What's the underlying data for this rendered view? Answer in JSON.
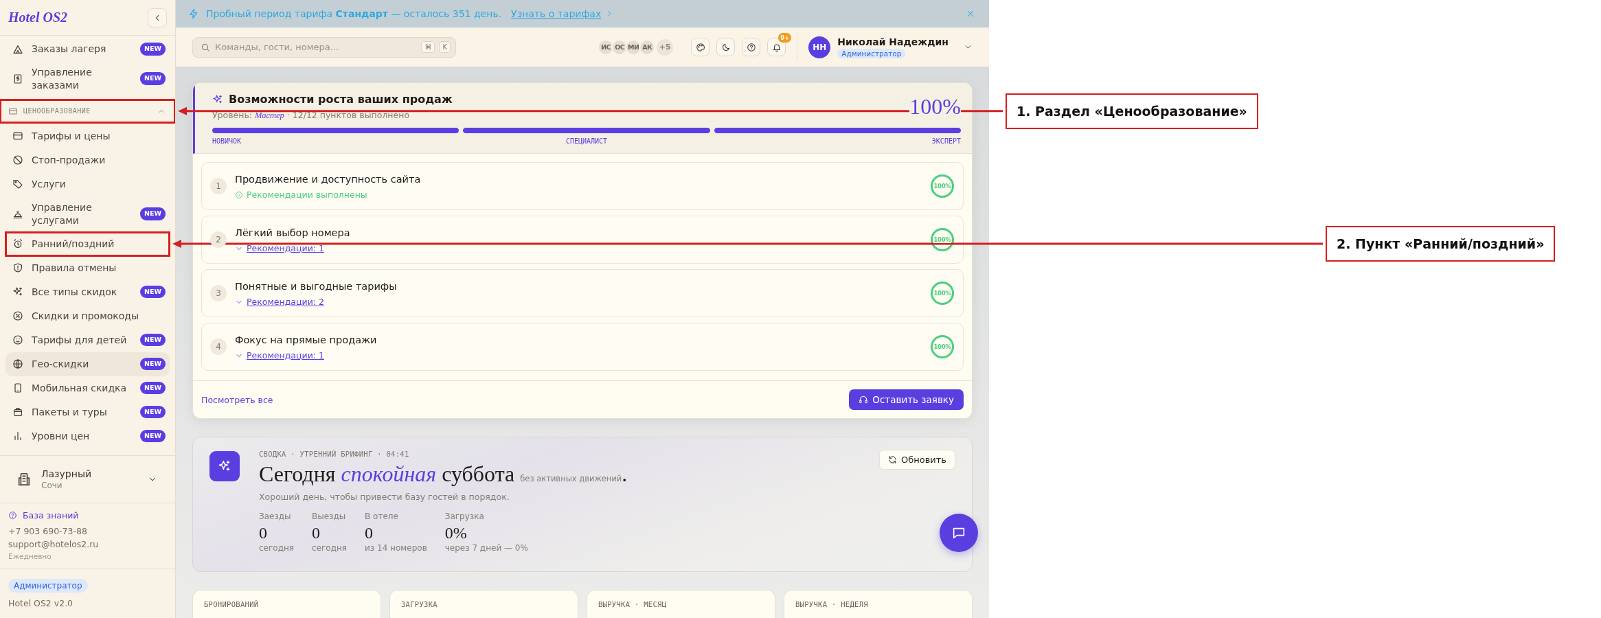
{
  "sidebar": {
    "logo": "Hotel OS2",
    "nav": [
      {
        "kind": "item",
        "label": "Заказы лагеря",
        "badge": "NEW",
        "selected": false,
        "highlighted": false
      },
      {
        "kind": "item",
        "label": "Управление заказами",
        "badge": "NEW",
        "selected": false,
        "highlighted": false
      },
      {
        "kind": "section",
        "label": "ЦЕНООБРАЗОВАНИЕ",
        "expanded": true,
        "highlighted": true
      },
      {
        "kind": "item",
        "label": "Тарифы и цены",
        "selected": false,
        "highlighted": false
      },
      {
        "kind": "item",
        "label": "Стоп-продажи",
        "selected": false,
        "highlighted": false
      },
      {
        "kind": "item",
        "label": "Услуги",
        "selected": false,
        "highlighted": false
      },
      {
        "kind": "item",
        "label": "Управление услугами",
        "badge": "NEW",
        "selected": false,
        "highlighted": false
      },
      {
        "kind": "item",
        "label": "Ранний/поздний",
        "selected": false,
        "highlighted": true
      },
      {
        "kind": "item",
        "label": "Правила отмены",
        "selected": false,
        "highlighted": false
      },
      {
        "kind": "item",
        "label": "Все типы скидок",
        "badge": "NEW",
        "selected": false,
        "highlighted": false
      },
      {
        "kind": "item",
        "label": "Скидки и промокоды",
        "selected": false,
        "highlighted": false
      },
      {
        "kind": "item",
        "label": "Тарифы для детей",
        "badge": "NEW",
        "selected": false,
        "highlighted": false
      },
      {
        "kind": "item",
        "label": "Гео-скидки",
        "badge": "NEW",
        "selected": true,
        "highlighted": false
      },
      {
        "kind": "item",
        "label": "Мобильная скидка",
        "badge": "NEW",
        "selected": false,
        "highlighted": false
      },
      {
        "kind": "item",
        "label": "Пакеты и туры",
        "badge": "NEW",
        "selected": false,
        "highlighted": false
      },
      {
        "kind": "item",
        "label": "Уровни цен",
        "badge": "NEW",
        "selected": false,
        "highlighted": false
      }
    ],
    "property": {
      "name": "Лазурный",
      "city": "Сочи"
    },
    "help": {
      "link": "База знаний",
      "phone": "+7 903 690-73-88",
      "email": "support@hotelos2.ru",
      "hours": "Ежедневно"
    },
    "footer": {
      "role": "Администратор",
      "version": "Hotel OS2 v2.0"
    }
  },
  "banner": {
    "text": "Пробный период тарифа **Стандарт** — осталось 351 день.",
    "link": "Узнать о тарифах"
  },
  "topbar": {
    "search": {
      "placeholder": "Команды, гости, номера...",
      "keys": [
        "⌘",
        "K"
      ]
    },
    "avatars": [
      "ИС",
      "ОС",
      "МИ",
      "АК"
    ],
    "more": "+5",
    "notifications": "9+",
    "user": {
      "initials": "НН",
      "name": "Николай Надеждин",
      "role": "Администратор"
    }
  },
  "growth": {
    "title": "Возможности роста ваших продаж",
    "level_line": "Уровень: *Мастер* · 12/12 пунктов выполнено",
    "percent": "100%",
    "stages": [
      {
        "label": "НОВИЧОК",
        "level": 1
      },
      {
        "label": "СПЕЦИАЛИСТ",
        "level": 1
      },
      {
        "label": "ЭКСПЕРТ",
        "level": 1
      }
    ],
    "tasks": [
      {
        "number": "1",
        "title": "Продвижение и доступность сайта",
        "kind": "done",
        "status": "Рекомендации выполнены",
        "percent": "100%",
        "level": 1
      },
      {
        "number": "2",
        "title": "Лёгкий выбор номера",
        "kind": "recs",
        "status": "Рекомендации: 1",
        "percent": "100%",
        "level": 1
      },
      {
        "number": "3",
        "title": "Понятные и выгодные тарифы",
        "kind": "recs",
        "status": "Рекомендации: 2",
        "percent": "100%",
        "level": 1
      },
      {
        "number": "4",
        "title": "Фокус на прямые продажи",
        "kind": "recs",
        "status": "Рекомендации: 1",
        "percent": "100%",
        "level": 1
      }
    ],
    "view_all": "Посмотреть все",
    "request": "Оставить заявку"
  },
  "briefing": {
    "eyebrow": "СВОДКА · УТРЕННИЙ БРИФИНГ · 04:41",
    "headline": "Сегодня *спокойная* суббота",
    "note": "без активных движений",
    "end": ".",
    "subtitle": "Хороший день, чтобы привести базу гостей в порядок.",
    "refresh": "Обновить",
    "stats": [
      {
        "label": "Заезды",
        "value": "0",
        "sub": "сегодня"
      },
      {
        "label": "Выезды",
        "value": "0",
        "sub": "сегодня"
      },
      {
        "label": "В отеле",
        "value": "0",
        "sub": "из 14 номеров"
      },
      {
        "label": "Загрузка",
        "value": "0%",
        "sub": "через 7 дней — 0%"
      }
    ]
  },
  "stat_cards": [
    "БРОНИРОВАНИЙ",
    "ЗАГРУЗКА",
    "ВЫРУЧКА · МЕСЯЦ",
    "ВЫРУЧКА · НЕДЕЛЯ"
  ],
  "annotations": [
    "1. Раздел «Ценообразование»",
    "2. Пункт «Ранний/поздний»"
  ]
}
